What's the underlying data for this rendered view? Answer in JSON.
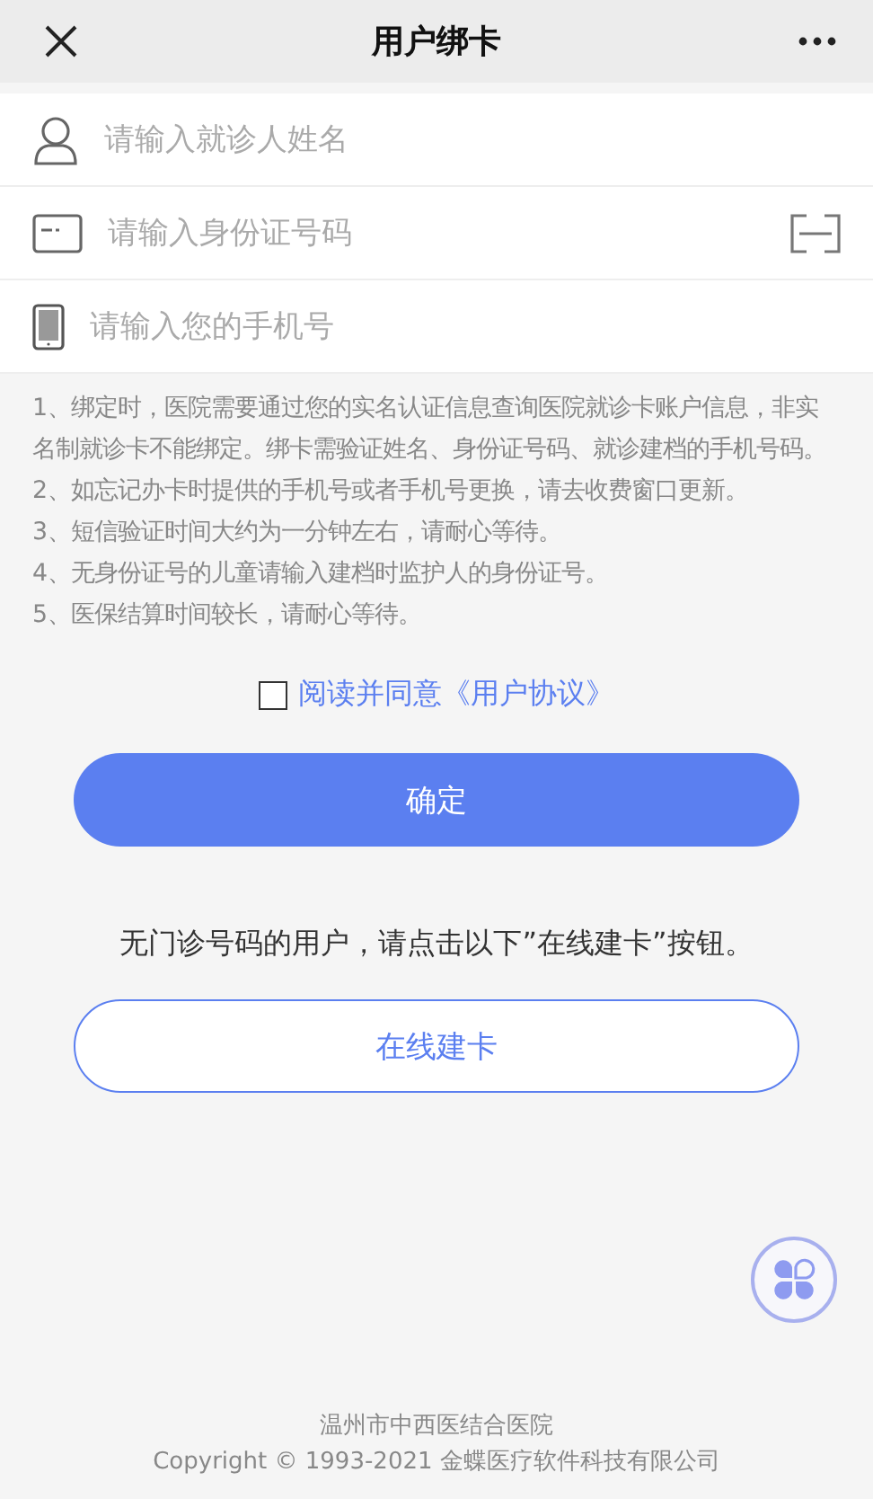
{
  "header": {
    "title": "用户绑卡"
  },
  "fields": [
    {
      "kind": "person",
      "placeholder": "请输入就诊人姓名",
      "scan": false
    },
    {
      "kind": "card",
      "placeholder": "请输入身份证号码",
      "scan": true
    },
    {
      "kind": "phone",
      "placeholder": "请输入您的手机号",
      "scan": false
    }
  ],
  "notes": [
    "1、绑定时，医院需要通过您的实名认证信息查询医院就诊卡账户信息，非实名制就诊卡不能绑定。绑卡需验证姓名、身份证号码、就诊建档的手机号码。",
    "2、如忘记办卡时提供的手机号或者手机号更换，请去收费窗口更新。",
    "3、短信验证时间大约为一分钟左右，请耐心等待。",
    "4、无身份证号的儿童请输入建档时监护人的身份证号。",
    "5、医保结算时间较长，请耐心等待。"
  ],
  "agreement": {
    "checked": false,
    "label": "阅读并同意《用户协议》"
  },
  "confirm_button": "确定",
  "hint": "无门诊号码的用户，请点击以下”在线建卡”按钮。",
  "online_button": "在线建卡",
  "footer": [
    "温州市中西医结合医院",
    "Copyright © 1993-2021 金蝶医疗软件科技有限公司"
  ]
}
